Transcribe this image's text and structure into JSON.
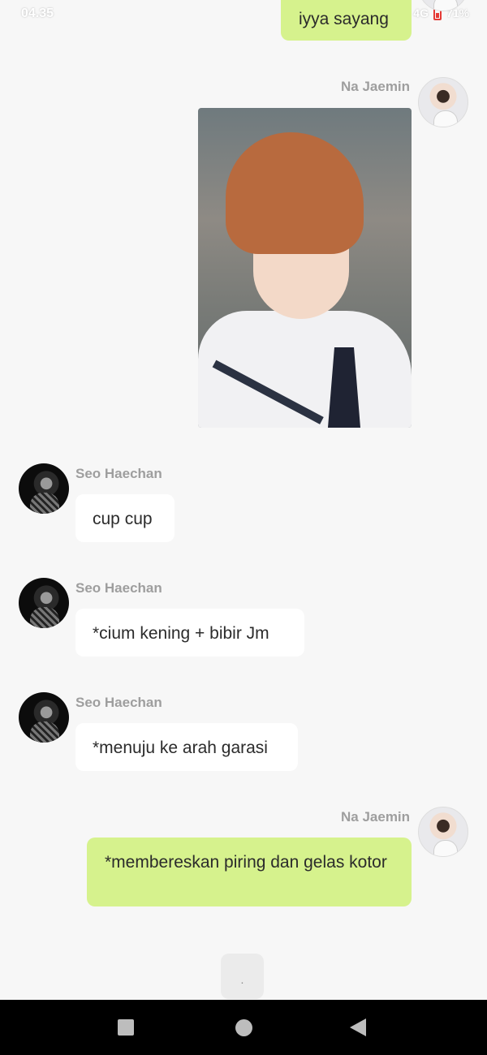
{
  "status_bar": {
    "time": "04.35",
    "network": "4G 4G",
    "battery": "71%"
  },
  "messages": [
    {
      "sender": "",
      "text": "iyya sayang"
    },
    {
      "sender": "Na Jaemin",
      "type": "image"
    },
    {
      "sender": "Seo Haechan",
      "text": "cup cup"
    },
    {
      "sender": "Seo Haechan",
      "text": "*cium kening + bibir Jm"
    },
    {
      "sender": "Seo Haechan",
      "text": "*menuju ke arah garasi"
    },
    {
      "sender": "Na Jaemin",
      "text": "*membereskan piring dan gelas kotor"
    }
  ],
  "typing_indicator": ".",
  "colors": {
    "own_bubble": "#d6f28d",
    "other_bubble": "#ffffff",
    "background": "#f7f7f7"
  }
}
